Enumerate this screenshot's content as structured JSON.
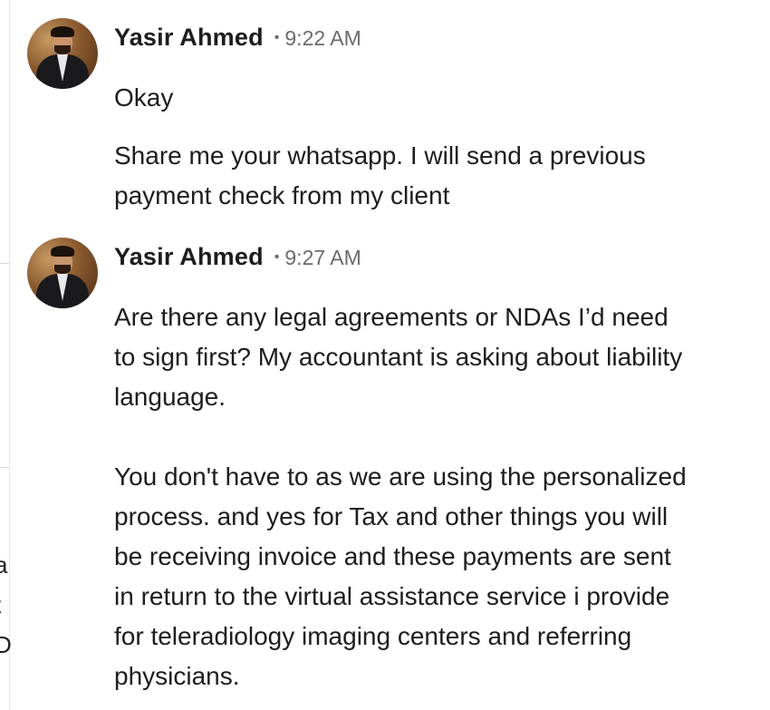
{
  "left_panel": {
    "cut_chars": [
      "a",
      "t",
      "D"
    ]
  },
  "messages": [
    {
      "sender": "Yasir Ahmed",
      "separator": "•",
      "time": "9:22 AM",
      "avatar": "profile-photo-avatar",
      "texts": [
        "Okay",
        "Share me your whatsapp. I will send a previous\npayment check from my client"
      ]
    },
    {
      "sender": "Yasir Ahmed",
      "separator": "•",
      "time": "9:27 AM",
      "avatar": "profile-photo-avatar",
      "texts": [
        "Are there any legal agreements or NDAs I’d need\nto sign first? My accountant is asking about liability\nlanguage.\n\nYou don't have to as we are using the personalized\nprocess. and yes for Tax and other things you will\nbe receiving invoice and these payments are sent\nin return to the virtual assistance service i provide\nfor teleradiology imaging centers and referring\nphysicians."
      ]
    }
  ]
}
